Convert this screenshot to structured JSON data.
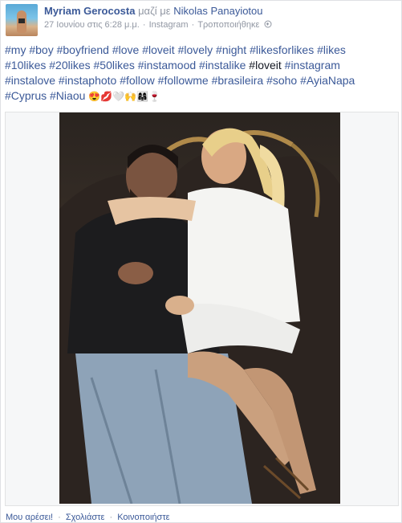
{
  "post": {
    "author": "Myriam Gerocosta",
    "with_text": "μαζί με",
    "tagged_person": "Nikolas Panayiotou",
    "date": "27 Ιουνίου στις 6:28 μ.μ.",
    "separator": "·",
    "app": "Instagram",
    "edited": "Τροποποιήθηκε",
    "hashtags_line1": "#my #boy #boyfriend #love #loveit #lovely #night #likesforlikes #likes",
    "hashtags_line2a": "#10likes #20likes #50likes #instamood #instalike ",
    "hashtags_line2_plain": "#loveit",
    "hashtags_line2b": " #instagram",
    "hashtags_line3": "#instalove #instaphoto #follow #followme #brasileira #soho #AyiaNapa",
    "hashtags_line4": "#Cyprus #Niaou",
    "emojis": "😍💋🤍🙌👩‍👩‍👧🍷"
  },
  "actions": {
    "like": "Μου αρέσει!",
    "comment": "Σχολιάστε",
    "share": "Κοινοποιήστε",
    "dot": "·"
  },
  "colors": {
    "link": "#3b5998",
    "meta": "#9197a3",
    "text": "#141823"
  }
}
